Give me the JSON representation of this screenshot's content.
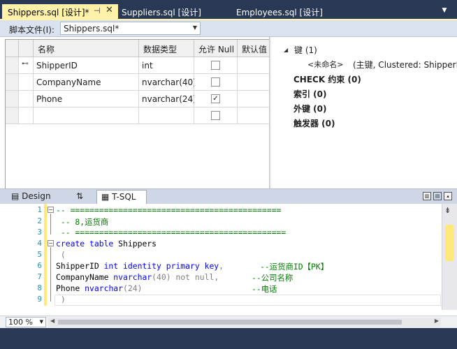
{
  "tabs": [
    {
      "label": "Shippers.sql [设计]*",
      "active": true
    },
    {
      "label": "Suppliers.sql [设计]",
      "active": false
    },
    {
      "label": "Employees.sql [设计]",
      "active": false
    }
  ],
  "filebar": {
    "label": "脚本文件(I):",
    "value": "Shippers.sql*"
  },
  "grid": {
    "headers": [
      "名称",
      "数据类型",
      "允许 Null",
      "默认值"
    ],
    "rows": [
      {
        "name": "ShipperID",
        "type": "int",
        "allow_null": false,
        "primary_key": true
      },
      {
        "name": "CompanyName",
        "type": "nvarchar(40)",
        "allow_null": false,
        "primary_key": false
      },
      {
        "name": "Phone",
        "type": "nvarchar(24)",
        "allow_null": true,
        "primary_key": false
      },
      {
        "name": "",
        "type": "",
        "allow_null": false,
        "primary_key": false
      }
    ]
  },
  "props": {
    "keys": "键 (1)",
    "unnamed": "<未命名>",
    "key_detail": "(主键, Clustered: ShipperI",
    "check": "CHECK 约束 (0)",
    "index": "索引 (0)",
    "fk": "外键 (0)",
    "trigger": "触发器 (0)"
  },
  "lower_tabs": {
    "design": "Design",
    "swap": "⇅",
    "tsql": "T-SQL"
  },
  "code": {
    "line_numbers": [
      "1",
      "2",
      "3",
      "4",
      "5",
      "6",
      "7",
      "8",
      "9"
    ],
    "l1": "-- ============================================",
    "l2": " -- 8,运货商",
    "l3": " -- ============================================",
    "l4_kw": "create table",
    "l4_tx": " Shippers",
    "l5": " (",
    "l6_a": "ShipperID ",
    "l6_b": "int identity primary key",
    "l6_c": ",",
    "l6_cm": "--运货商ID【PK】",
    "l7_a": "CompanyName ",
    "l7_b": "nvarchar",
    "l7_c": "(40) ",
    "l7_d": "not null",
    "l7_e": ",",
    "l7_cm": "--公司名称",
    "l8_a": "Phone ",
    "l8_b": "nvarchar",
    "l8_c": "(24)",
    "l8_cm": "--电话",
    "l9": " )"
  },
  "zoom": "100 %",
  "colors": {
    "accent": "#fff1a8",
    "chrome": "#293955",
    "keyword": "#0000ff",
    "comment": "#008000"
  }
}
